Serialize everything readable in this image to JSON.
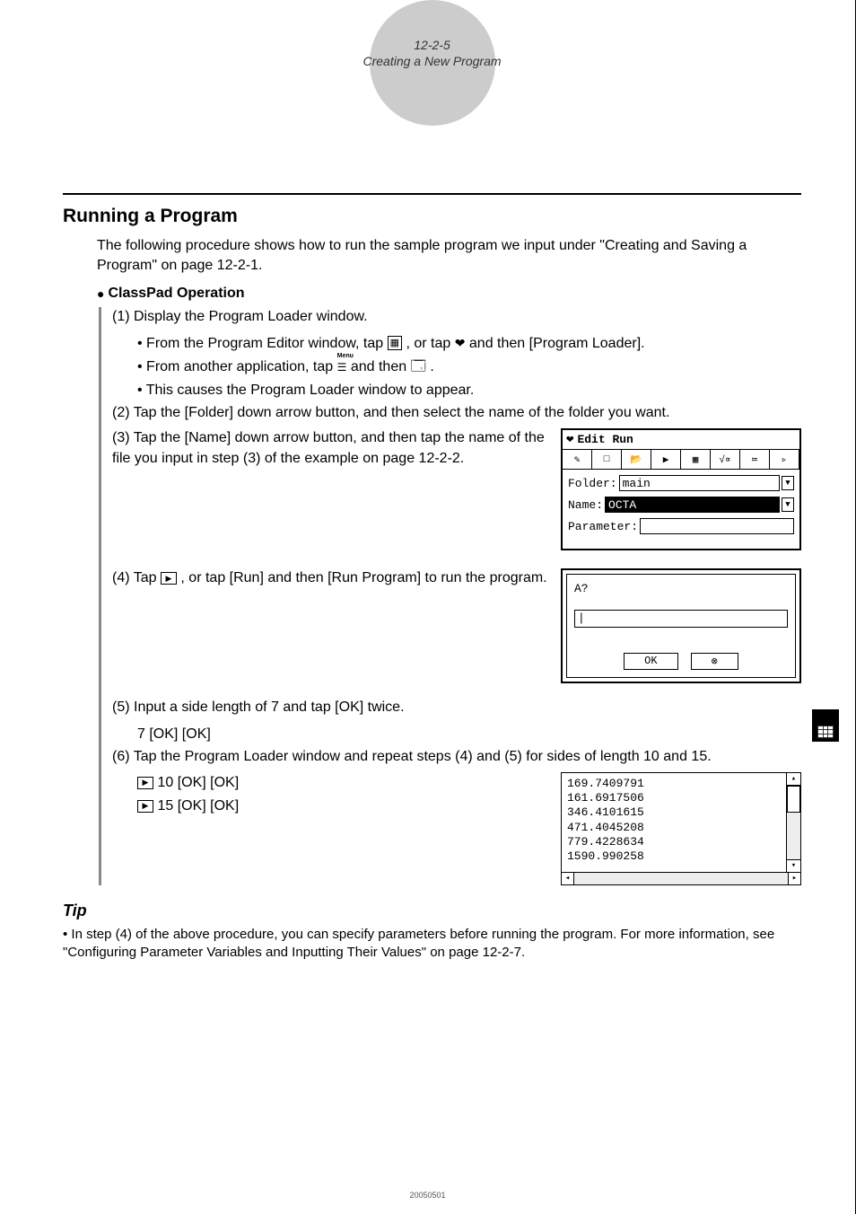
{
  "header": {
    "page_ref": "12-2-5",
    "subtitle": "Creating a New Program"
  },
  "section_title": "Running a Program",
  "intro": "The following procedure shows how to run the sample program we input under \"Creating and Saving a Program\" on page 12-2-1.",
  "operation_title": "ClassPad Operation",
  "steps": {
    "s1": "(1) Display the Program Loader window.",
    "s1a_pre": "• From the Program Editor window, tap ",
    "s1a_mid": ", or tap ",
    "s1a_post": " and then [Program Loader].",
    "s1b_pre": "• From another application, tap ",
    "s1b_mid": " and then ",
    "s1b_post": ".",
    "s1c": "• This causes the Program Loader window to appear.",
    "s2": "(2) Tap the [Folder] down arrow button, and then select the name of the folder you want.",
    "s3": "(3) Tap the [Name] down arrow button, and then tap the name of the file you input in step (3) of the example on page 12-2-2.",
    "s4_pre": "(4) Tap ",
    "s4_post": ", or tap [Run] and then [Run Program] to run the program.",
    "s5": "(5) Input a side length of 7 and tap [OK] twice.",
    "s5a": "7 [OK] [OK]",
    "s6": "(6) Tap the Program Loader window and repeat steps (4) and (5) for sides of length 10 and 15.",
    "s6a": "10 [OK] [OK]",
    "s6b": "15 [OK] [OK]"
  },
  "calc_window": {
    "title": "Edit Run",
    "folder_label": "Folder:",
    "folder_value": "main",
    "name_label": "Name:",
    "name_value": "OCTA",
    "param_label": "Parameter:",
    "param_value": ""
  },
  "dialog": {
    "prompt": "A?",
    "input": "",
    "ok": "OK",
    "cancel": "⊗"
  },
  "output_lines": "169.7409791\n161.6917506\n346.4101615\n471.4045208\n779.4228634\n1590.990258",
  "tip": {
    "title": "Tip",
    "body": "• In step (4) of the above procedure, you can specify parameters before running the program. For more information, see \"Configuring Parameter Variables and Inputting Their Values\" on page 12-2-7."
  },
  "menu_label": "Menu",
  "footer": "20050501"
}
